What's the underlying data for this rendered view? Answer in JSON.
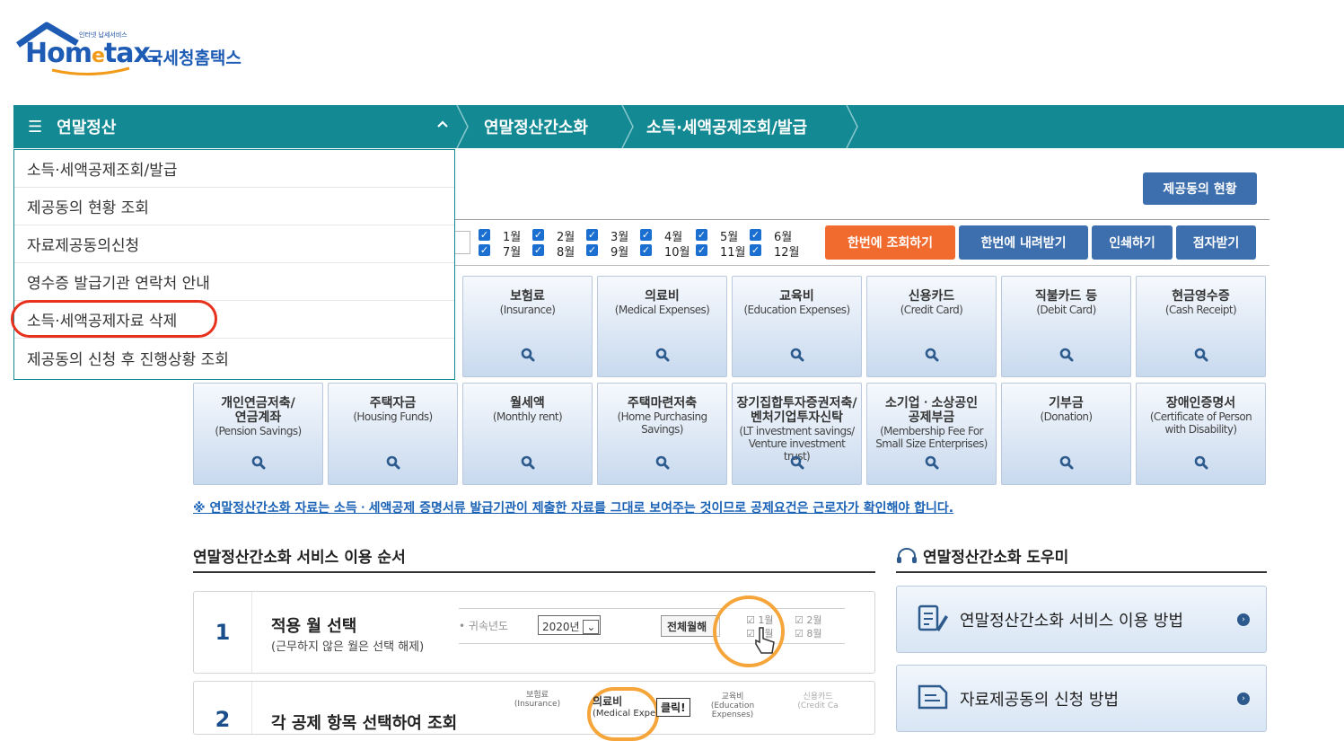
{
  "logo": {
    "sub": "인터넷 납세서비스",
    "word_a": "Hom",
    "word_e": "e",
    "word_b": "tax.",
    "korean": "국세청홈택스"
  },
  "nav": {
    "menu_label": "연말정산",
    "breadcrumbs": [
      "연말정산간소화",
      "소득·세액공제조회/발급"
    ]
  },
  "dropdown": {
    "items": [
      "소득·세액공제조회/발급",
      "제공동의 현황 조회",
      "자료제공동의신청",
      "영수증 발급기관 연락처 안내",
      "소득·세액공제자료 삭제",
      "제공동의 신청 후 진행상황 조회"
    ]
  },
  "status_button": "제공동의 현황",
  "months": {
    "row1": [
      "1월",
      "2월",
      "3월",
      "4월",
      "5월",
      "6월"
    ],
    "row2": [
      "7월",
      "8월",
      "9월",
      "10월",
      "11월",
      "12월"
    ]
  },
  "actions": {
    "query": "한번에 조회하기",
    "download": "한번에 내려받기",
    "print": "인쇄하기",
    "braille": "점자받기"
  },
  "cards_row1": [
    {
      "kr": "보험료",
      "en": "(Insurance)"
    },
    {
      "kr": "의료비",
      "en": "(Medical Expenses)"
    },
    {
      "kr": "교육비",
      "en": "(Education Expenses)"
    },
    {
      "kr": "신용카드",
      "en": "(Credit Card)"
    },
    {
      "kr": "직불카드 등",
      "en": "(Debit Card)"
    },
    {
      "kr": "현금영수증",
      "en": "(Cash Receipt)"
    }
  ],
  "cards_row2": [
    {
      "kr": "개인연금저축/\n연금계좌",
      "en": "(Pension Savings)"
    },
    {
      "kr": "주택자금",
      "en": "(Housing Funds)"
    },
    {
      "kr": "월세액",
      "en": "(Monthly rent)"
    },
    {
      "kr": "주택마련저축",
      "en": "(Home Purchasing Savings)"
    },
    {
      "kr": "장기집합투자증권저축/\n벤처기업투자신탁",
      "en": "(LT investment savings/ Venture investment trust)"
    },
    {
      "kr": "소기업ㆍ소상공인\n공제부금",
      "en": "(Membership Fee For Small Size Enterprises)"
    },
    {
      "kr": "기부금",
      "en": "(Donation)"
    },
    {
      "kr": "장애인증명서",
      "en": "(Certificate of Person with Disability)"
    }
  ],
  "notice": "※ 연말정산간소화 자료는 소득ㆍ세액공제 증명서류 발급기관이 제출한 자료를 그대로 보여주는 것이므로 공제요건은 근로자가 확인해야 합니다.",
  "order": {
    "title": "연말정산간소화 서비스 이용 순서",
    "steps": [
      {
        "num": "1",
        "title": "적용 월 선택",
        "desc": "(근무하지 않은 월은 선택 해제)",
        "demo": {
          "year_label": "귀속년도",
          "year_value": "2020년",
          "all_button": "전체월해",
          "m1": "1월",
          "m2": "2월",
          "m7": "7월",
          "m8": "8월"
        }
      },
      {
        "num": "2",
        "title": "각 공제 항목 선택하여 조회",
        "demo": {
          "a": "보험료",
          "a_en": "(Insurance)",
          "b": "의료비",
          "b_en": "(Medical Expen",
          "click": "클릭!",
          "c": "교육비",
          "c_en": "(Education Expenses)",
          "d": "신용카드",
          "d_en": "(Credit Ca"
        }
      }
    ]
  },
  "helper": {
    "title": "연말정산간소화 도우미",
    "items": [
      "연말정산간소화 서비스 이용 방법",
      "자료제공동의 신청 방법"
    ]
  },
  "colors": {
    "nav": "#138a93",
    "button_blue": "#3d6fae",
    "button_orange": "#f26b2e",
    "highlight": "#e8311d"
  }
}
